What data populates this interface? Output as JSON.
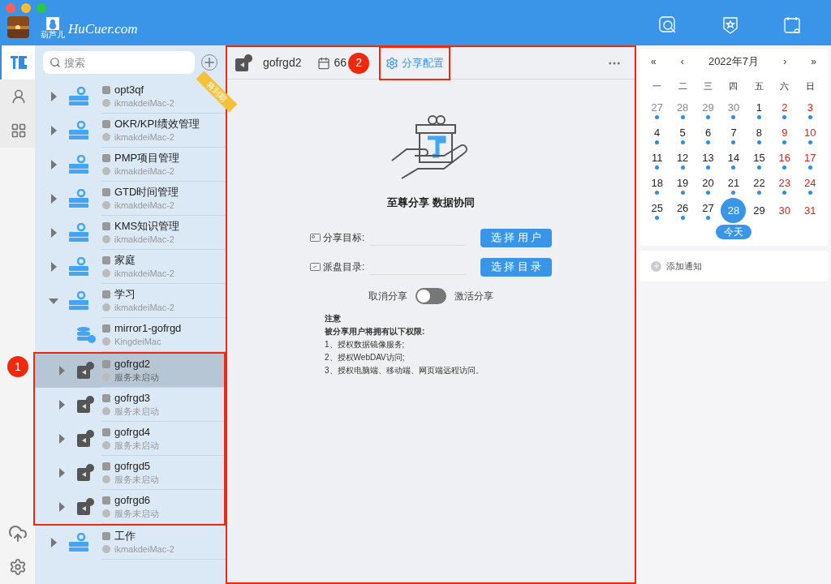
{
  "titlebar": {
    "logo_text": "HuCuer.com",
    "logo_sub": "葫芦儿"
  },
  "rail": {
    "items": [
      {
        "kind": "logo",
        "selected": true
      },
      {
        "kind": "users",
        "selected": false
      },
      {
        "kind": "apps",
        "selected": false
      }
    ]
  },
  "sidebar": {
    "search": {
      "placeholder": "搜索"
    },
    "ribbon": "将到期",
    "items": [
      {
        "kind": "drive",
        "name": "opt3qf",
        "host": "ikmakdeiMac-2",
        "expanded": false,
        "selected": false
      },
      {
        "kind": "drive",
        "name": "OKR/KPI绩效管理",
        "host": "ikmakdeiMac-2",
        "expanded": false,
        "selected": false
      },
      {
        "kind": "drive",
        "name": "PMP项目管理",
        "host": "ikmakdeiMac-2",
        "expanded": false,
        "selected": false
      },
      {
        "kind": "drive",
        "name": "GTD时间管理",
        "host": "ikmakdeiMac-2",
        "expanded": false,
        "selected": false
      },
      {
        "kind": "drive",
        "name": "KMS知识管理",
        "host": "ikmakdeiMac-2",
        "expanded": false,
        "selected": false
      },
      {
        "kind": "drive",
        "name": "家庭",
        "host": "ikmakdeiMac-2",
        "expanded": false,
        "selected": false
      },
      {
        "kind": "drive",
        "name": "学习",
        "host": "ikmakdeiMac-2",
        "expanded": true,
        "selected": false,
        "children": [
          {
            "kind": "mirror",
            "name": "mirror1-gofrgd",
            "host": "KingdeiMac",
            "selected": false
          },
          {
            "kind": "share",
            "name": "gofrgd2",
            "host": "服务未启动",
            "expanded": false,
            "selected": true
          },
          {
            "kind": "share",
            "name": "gofrgd3",
            "host": "服务未启动",
            "expanded": false,
            "selected": false
          },
          {
            "kind": "share",
            "name": "gofrgd4",
            "host": "服务未启动",
            "expanded": false,
            "selected": false
          },
          {
            "kind": "share",
            "name": "gofrgd5",
            "host": "服务未启动",
            "expanded": false,
            "selected": false
          },
          {
            "kind": "share",
            "name": "gofrgd6",
            "host": "服务未启动",
            "expanded": false,
            "selected": false
          }
        ]
      },
      {
        "kind": "drive",
        "name": "工作",
        "host": "ikmakdeiMac-2",
        "expanded": false,
        "selected": false
      }
    ]
  },
  "annotations": [
    {
      "number": "1"
    },
    {
      "number": "2"
    }
  ],
  "main": {
    "header": {
      "name": "gofrgd2",
      "count": "66",
      "tab": {
        "label": "分享配置",
        "selected": true
      }
    },
    "title": "至尊分享 数据协同",
    "fields": [
      {
        "kind": "user",
        "label": "分享目标:",
        "button": "选 择 用 户"
      },
      {
        "kind": "folder",
        "label": "派盘目录:",
        "button": "选 择 目 录"
      }
    ],
    "toggle": {
      "off_label": "取消分享",
      "on_label": "激活分享",
      "on": false
    },
    "notes": {
      "heading": "注意",
      "subheading": "被分享用户将拥有以下权限:",
      "lines": [
        "1、授权数据镜像服务;",
        "2、授权WebDAV访问;",
        "3、授权电脑端、移动端、网页端远程访问。"
      ]
    }
  },
  "calendar": {
    "nav": [
      "«",
      "‹",
      "›",
      "»"
    ],
    "title": "2022年7月",
    "weekdays": [
      "一",
      "二",
      "三",
      "四",
      "五",
      "六",
      "日"
    ],
    "days": [
      {
        "text": "27",
        "kind": "other",
        "dot": true
      },
      {
        "text": "28",
        "kind": "other",
        "dot": true
      },
      {
        "text": "29",
        "kind": "other",
        "dot": true
      },
      {
        "text": "30",
        "kind": "other",
        "dot": true
      },
      {
        "text": "1",
        "kind": "normal",
        "dot": true
      },
      {
        "text": "2",
        "kind": "weekend",
        "dot": true
      },
      {
        "text": "3",
        "kind": "weekend",
        "dot": true
      },
      {
        "text": "4",
        "kind": "normal",
        "dot": true
      },
      {
        "text": "5",
        "kind": "normal",
        "dot": true
      },
      {
        "text": "6",
        "kind": "normal",
        "dot": true
      },
      {
        "text": "7",
        "kind": "normal",
        "dot": true
      },
      {
        "text": "8",
        "kind": "normal",
        "dot": true
      },
      {
        "text": "9",
        "kind": "weekend",
        "dot": true
      },
      {
        "text": "10",
        "kind": "weekend",
        "dot": true
      },
      {
        "text": "11",
        "kind": "normal",
        "dot": true
      },
      {
        "text": "12",
        "kind": "normal",
        "dot": true
      },
      {
        "text": "13",
        "kind": "normal",
        "dot": true
      },
      {
        "text": "14",
        "kind": "normal",
        "dot": true
      },
      {
        "text": "15",
        "kind": "normal",
        "dot": true
      },
      {
        "text": "16",
        "kind": "weekend",
        "dot": true
      },
      {
        "text": "17",
        "kind": "weekend",
        "dot": true
      },
      {
        "text": "18",
        "kind": "normal",
        "dot": true
      },
      {
        "text": "19",
        "kind": "normal",
        "dot": true
      },
      {
        "text": "20",
        "kind": "normal",
        "dot": true
      },
      {
        "text": "21",
        "kind": "normal",
        "dot": true
      },
      {
        "text": "22",
        "kind": "normal",
        "dot": true
      },
      {
        "text": "23",
        "kind": "weekend",
        "dot": true
      },
      {
        "text": "24",
        "kind": "weekend",
        "dot": true
      },
      {
        "text": "25",
        "kind": "normal",
        "dot": true
      },
      {
        "text": "26",
        "kind": "normal",
        "dot": true
      },
      {
        "text": "27",
        "kind": "normal",
        "dot": true
      },
      {
        "text": "28",
        "kind": "today",
        "dot": false
      },
      {
        "text": "29",
        "kind": "normal",
        "dot": false
      },
      {
        "text": "30",
        "kind": "weekend",
        "dot": false
      },
      {
        "text": "31",
        "kind": "weekend",
        "dot": false
      }
    ],
    "today_button": "今天",
    "add_notice": "添加通知"
  }
}
